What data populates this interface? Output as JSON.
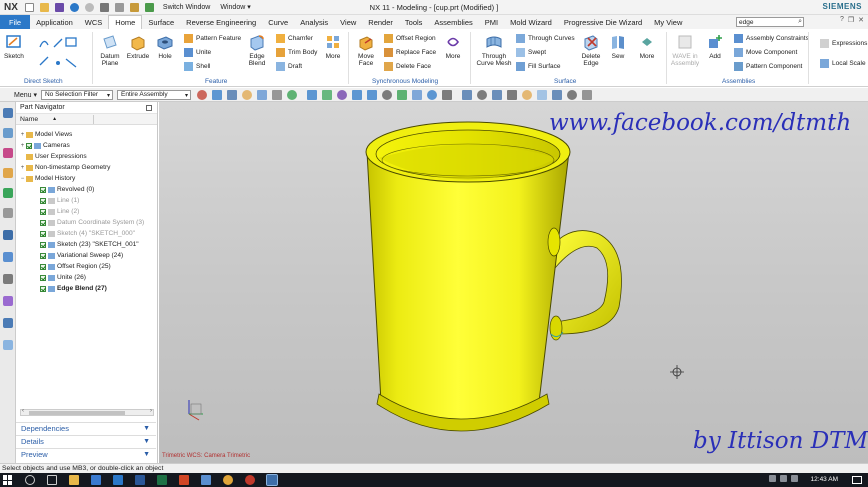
{
  "titlebar": {
    "logo": "NX",
    "switch_window": "Switch Window",
    "window_menu": "Window",
    "window_caret": "▾",
    "title": "NX 11 - Modeling - [cup.prt (Modified) ]",
    "brand": "SIEMENS"
  },
  "tabs": [
    "File",
    "Application",
    "WCS",
    "Home",
    "Surface",
    "Reverse Engineering",
    "Curve",
    "Analysis",
    "View",
    "Render",
    "Tools",
    "Assemblies",
    "PMI",
    "Mold Wizard",
    "Progressive Die Wizard",
    "My View"
  ],
  "active_tab": "Home",
  "search": {
    "value": "edge"
  },
  "ribbon": {
    "sketch": "Sketch",
    "datum_plane": "Datum Plane",
    "extrude": "Extrude",
    "hole": "Hole",
    "pattern_feature": "Pattern Feature",
    "unite": "Unite",
    "shell": "Shell",
    "edge_blend": "Edge Blend",
    "chamfer": "Chamfer",
    "trim_body": "Trim Body",
    "draft": "Draft",
    "more": "More",
    "move_face": "Move Face",
    "offset_region": "Offset Region",
    "replace_face": "Replace Face",
    "delete_face": "Delete Face",
    "through_curve_mesh": "Through Curve Mesh",
    "through_curves": "Through Curves",
    "swept": "Swept",
    "fill_surface": "Fill Surface",
    "delete_edge": "Delete Edge",
    "sew": "Sew",
    "wave_link": "WAVE in Assembly",
    "add": "Add",
    "assembly_constraints": "Assembly Constraints",
    "move_component": "Move Component",
    "pattern_component": "Pattern Component",
    "expressions": "Expressions",
    "local_scale": "Local Scale",
    "groups": {
      "direct_sketch": "Direct Sketch",
      "feature": "Feature",
      "synchronous": "Synchronous Modeling",
      "surface": "Surface",
      "assemblies": "Assemblies"
    }
  },
  "selbar": {
    "menu": "Menu",
    "menu_caret": "▾",
    "filter": "No Selection Filter",
    "scope": "Entire Assembly"
  },
  "navigator": {
    "title": "Part Navigator",
    "col_name": "Name",
    "col_sort": "▲",
    "tree": [
      {
        "label": "Model Views",
        "exp": "+",
        "kind": "folder",
        "indent": 0
      },
      {
        "label": "Cameras",
        "exp": "+",
        "kind": "check",
        "indent": 0
      },
      {
        "label": "User Expressions",
        "exp": "",
        "kind": "folder",
        "indent": 0
      },
      {
        "label": "Non-timestamp Geometry",
        "exp": "+",
        "kind": "folder",
        "indent": 0
      },
      {
        "label": "Model History",
        "exp": "−",
        "kind": "folder",
        "indent": 0
      },
      {
        "label": "Revolved (0)",
        "exp": "",
        "kind": "check",
        "indent": 1
      },
      {
        "label": "Line (1)",
        "exp": "",
        "kind": "check",
        "indent": 1,
        "grey": true
      },
      {
        "label": "Line (2)",
        "exp": "",
        "kind": "check",
        "indent": 1,
        "grey": true
      },
      {
        "label": "Datum Coordinate System (3)",
        "exp": "",
        "kind": "check",
        "indent": 1,
        "grey": true
      },
      {
        "label": "Sketch (4) \"SKETCH_000\"",
        "exp": "",
        "kind": "check",
        "indent": 1,
        "grey": true
      },
      {
        "label": "Sketch (23) \"SKETCH_001\"",
        "exp": "",
        "kind": "check",
        "indent": 1
      },
      {
        "label": "Variational Sweep (24)",
        "exp": "",
        "kind": "check",
        "indent": 1
      },
      {
        "label": "Offset Region (25)",
        "exp": "",
        "kind": "check",
        "indent": 1
      },
      {
        "label": "Unite (26)",
        "exp": "",
        "kind": "check",
        "indent": 1
      },
      {
        "label": "Edge Blend (27)",
        "exp": "",
        "kind": "check",
        "indent": 1,
        "bold": true
      }
    ],
    "panels": [
      "Dependencies",
      "Details",
      "Preview"
    ],
    "panel_chevron": "▼"
  },
  "viewport": {
    "watermark_top": "www.facebook.com/dtmth",
    "watermark_bottom": "by Ittison DTM",
    "view_label": "Trimetric  WCS:  Camera  Trimetric"
  },
  "status": "Select objects and use MB3, or double-click an object",
  "taskbar": {
    "clock": "12:43 AM"
  },
  "colors": {
    "accent": "#2b78c8",
    "part": "#ffff1a",
    "watermark": "#2a2fb8"
  }
}
